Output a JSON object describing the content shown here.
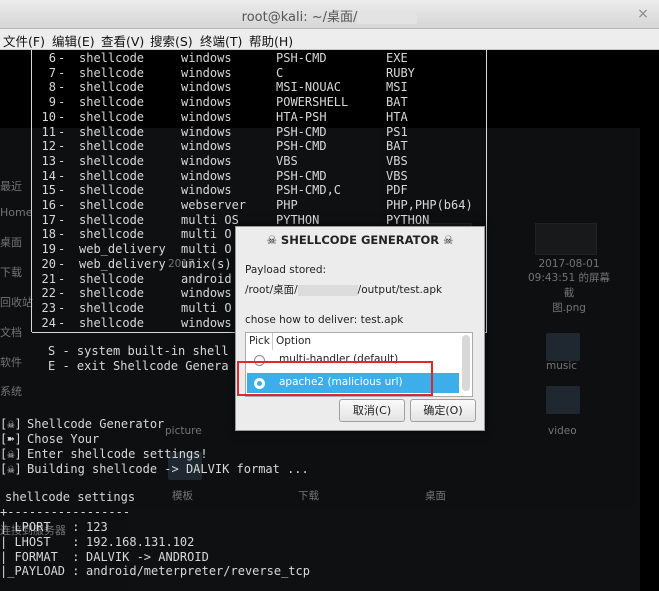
{
  "window": {
    "title": "root@kali: ~/桌面/",
    "close_glyph": "×"
  },
  "menu": [
    "文件(F)",
    "编辑(E)",
    "查看(V)",
    "搜索(S)",
    "终端(T)",
    "帮助(H)"
  ],
  "table_rows": [
    {
      "num": "6",
      "name": "shellcode",
      "os": "windows",
      "fmt": "PSH-CMD",
      "ext": "EXE"
    },
    {
      "num": "7",
      "name": "shellcode",
      "os": "windows",
      "fmt": "C",
      "ext": "RUBY"
    },
    {
      "num": "8",
      "name": "shellcode",
      "os": "windows",
      "fmt": "MSI-NOUAC",
      "ext": "MSI"
    },
    {
      "num": "9",
      "name": "shellcode",
      "os": "windows",
      "fmt": "POWERSHELL",
      "ext": "BAT"
    },
    {
      "num": "10",
      "name": "shellcode",
      "os": "windows",
      "fmt": "HTA-PSH",
      "ext": "HTA"
    },
    {
      "num": "11",
      "name": "shellcode",
      "os": "windows",
      "fmt": "PSH-CMD",
      "ext": "PS1"
    },
    {
      "num": "12",
      "name": "shellcode",
      "os": "windows",
      "fmt": "PSH-CMD",
      "ext": "BAT"
    },
    {
      "num": "13",
      "name": "shellcode",
      "os": "windows",
      "fmt": "VBS",
      "ext": "VBS"
    },
    {
      "num": "14",
      "name": "shellcode",
      "os": "windows",
      "fmt": "PSH-CMD",
      "ext": "VBS"
    },
    {
      "num": "15",
      "name": "shellcode",
      "os": "windows",
      "fmt": "PSH-CMD,C",
      "ext": "PDF"
    },
    {
      "num": "16",
      "name": "shellcode",
      "os": "webserver",
      "fmt": "PHP",
      "ext": "PHP,PHP(b64)"
    },
    {
      "num": "17",
      "name": "shellcode",
      "os": "multi OS",
      "fmt": "PYTHON",
      "ext": "PYTHON"
    },
    {
      "num": "18",
      "name": "shellcode",
      "os": "multi O",
      "fmt": "",
      "ext": ""
    },
    {
      "num": "19",
      "name": "web_delivery",
      "os": "multi O",
      "fmt": "",
      "ext": ""
    },
    {
      "num": "20",
      "name": "web_delivery",
      "os": "unix(s)",
      "fmt": "",
      "ext": ""
    },
    {
      "num": "21",
      "name": "shellcode",
      "os": "android",
      "fmt": "",
      "ext": ""
    },
    {
      "num": "22",
      "name": "shellcode",
      "os": "windows",
      "fmt": "",
      "ext": ""
    },
    {
      "num": "23",
      "name": "shellcode",
      "os": "multi O",
      "fmt": "",
      "ext": ""
    },
    {
      "num": "24",
      "name": "shellcode",
      "os": "windows",
      "fmt": "",
      "ext": ""
    }
  ],
  "options": {
    "system": "S - system built-in shell",
    "exit": "E - exit Shellcode Genera"
  },
  "log": [
    {
      "mark": "[☠]",
      "text": "Shellcode Generator"
    },
    {
      "mark": "[➽]",
      "text": "Chose Your"
    },
    {
      "mark": "[☠]",
      "text": "Enter shellcode settings!"
    },
    {
      "mark": "[☠]",
      "text": "Building shellcode -> DALVIK format ..."
    }
  ],
  "settings": {
    "heading": "shellcode settings",
    "divider": "+-----------------",
    "rows": [
      {
        "key": "| LPORT   :",
        "val": "123"
      },
      {
        "key": "| LHOST   :",
        "val": "192.168.131.102"
      },
      {
        "key": "| FORMAT  :",
        "val": "DALVIK -> ANDROID"
      },
      {
        "key": "|_PAYLOAD :",
        "val": "android/meterpreter/reverse_tcp"
      }
    ]
  },
  "file_manager": {
    "sidebar": [
      "最近",
      "Home",
      "桌面",
      "下载",
      "回收站",
      "文档",
      "软件",
      "系统",
      "连接到服务器"
    ],
    "files": [
      {
        "name": "2017-08-01\n09:43:51 的屏幕截\n图.png"
      },
      {
        "name": "music"
      },
      {
        "name": "video"
      },
      {
        "name": "picture"
      },
      {
        "name": "模板"
      },
      {
        "name": "下载"
      },
      {
        "name": "桌面"
      }
    ],
    "partial_dates": [
      "2017",
      "2017-08-01"
    ]
  },
  "dialog": {
    "title": "☠ SHELLCODE GENERATOR ☠",
    "stored_label": "Payload stored:",
    "stored_path_prefix": "/root/桌面/",
    "stored_path_suffix": "/output/test.apk",
    "prompt": "chose how to deliver: test.apk",
    "col_pick": "Pick",
    "col_option": "Option",
    "items": [
      {
        "label": "multi-handler (default)",
        "selected": false
      },
      {
        "label": "apache2 (malicious url)",
        "selected": true
      }
    ],
    "cancel": "取消(C)",
    "ok": "确定(O)"
  },
  "colors": {
    "highlight_row": "#3daee9",
    "annotation": "#e0282c",
    "terminal_bg": "#000000"
  }
}
